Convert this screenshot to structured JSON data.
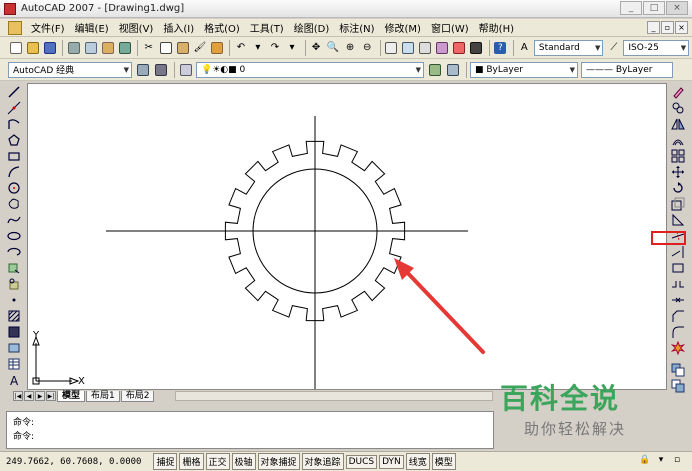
{
  "window": {
    "title": "AutoCAD 2007 - [Drawing1.dwg]",
    "controls": [
      "_",
      "□",
      "×"
    ]
  },
  "menubar": {
    "items": [
      "文件(F)",
      "编辑(E)",
      "视图(V)",
      "插入(I)",
      "格式(O)",
      "工具(T)",
      "绘图(D)",
      "标注(N)",
      "修改(M)",
      "窗口(W)",
      "帮助(H)"
    ],
    "doc_controls": [
      "_",
      "▫",
      "×"
    ]
  },
  "toolbar1": {
    "text_style": "Standard",
    "dim_style": "ISO-25"
  },
  "toolbar2": {
    "workspace": "AutoCAD 经典",
    "layer": "0",
    "color": "ByLayer",
    "linetype": "ByLayer"
  },
  "tabs": {
    "nav": [
      "|◀",
      "◀",
      "▶",
      "▶|"
    ],
    "items": [
      "模型",
      "布局1",
      "布局2"
    ]
  },
  "command": {
    "line1": "命令:",
    "line2": "命令:"
  },
  "statusbar": {
    "coords": "249.7662,  60.7608,  0.0000",
    "toggles": [
      "捕捉",
      "栅格",
      "正交",
      "极轴",
      "对象捕捉",
      "对象追踪",
      "DUCS",
      "DYN",
      "线宽",
      "模型"
    ]
  },
  "ucs": {
    "x_label": "X",
    "y_label": "Y"
  },
  "watermark": {
    "title": "百科全说",
    "subtitle": "助你轻松解决"
  },
  "colors": {
    "highlight": "#e02020",
    "arrow": "#e53935",
    "watermark_green": "#3ba55c"
  }
}
